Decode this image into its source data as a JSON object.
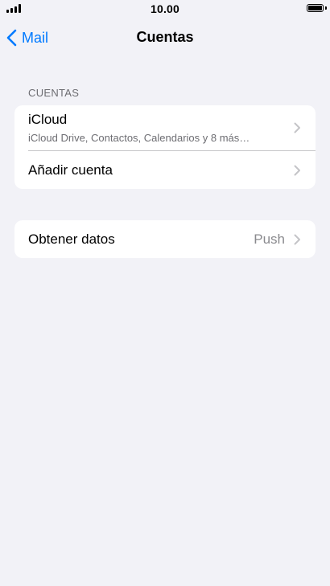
{
  "status_bar": {
    "time": "10.00",
    "signal_icon": "signal-bars-icon",
    "battery_icon": "battery-full-icon"
  },
  "nav": {
    "back_label": "Mail",
    "back_icon": "chevron-left-icon",
    "title": "Cuentas"
  },
  "accounts_section": {
    "header": "CUENTAS",
    "items": [
      {
        "title": "iCloud",
        "subtitle": "iCloud Drive, Contactos, Calendarios y 8 más…"
      },
      {
        "title": "Añadir cuenta"
      }
    ]
  },
  "fetch_section": {
    "title": "Obtener datos",
    "value": "Push"
  },
  "colors": {
    "background": "#f2f2f7",
    "accent": "#007aff",
    "secondary_text": "#6d6d72",
    "chevron": "#c4c4c7"
  }
}
